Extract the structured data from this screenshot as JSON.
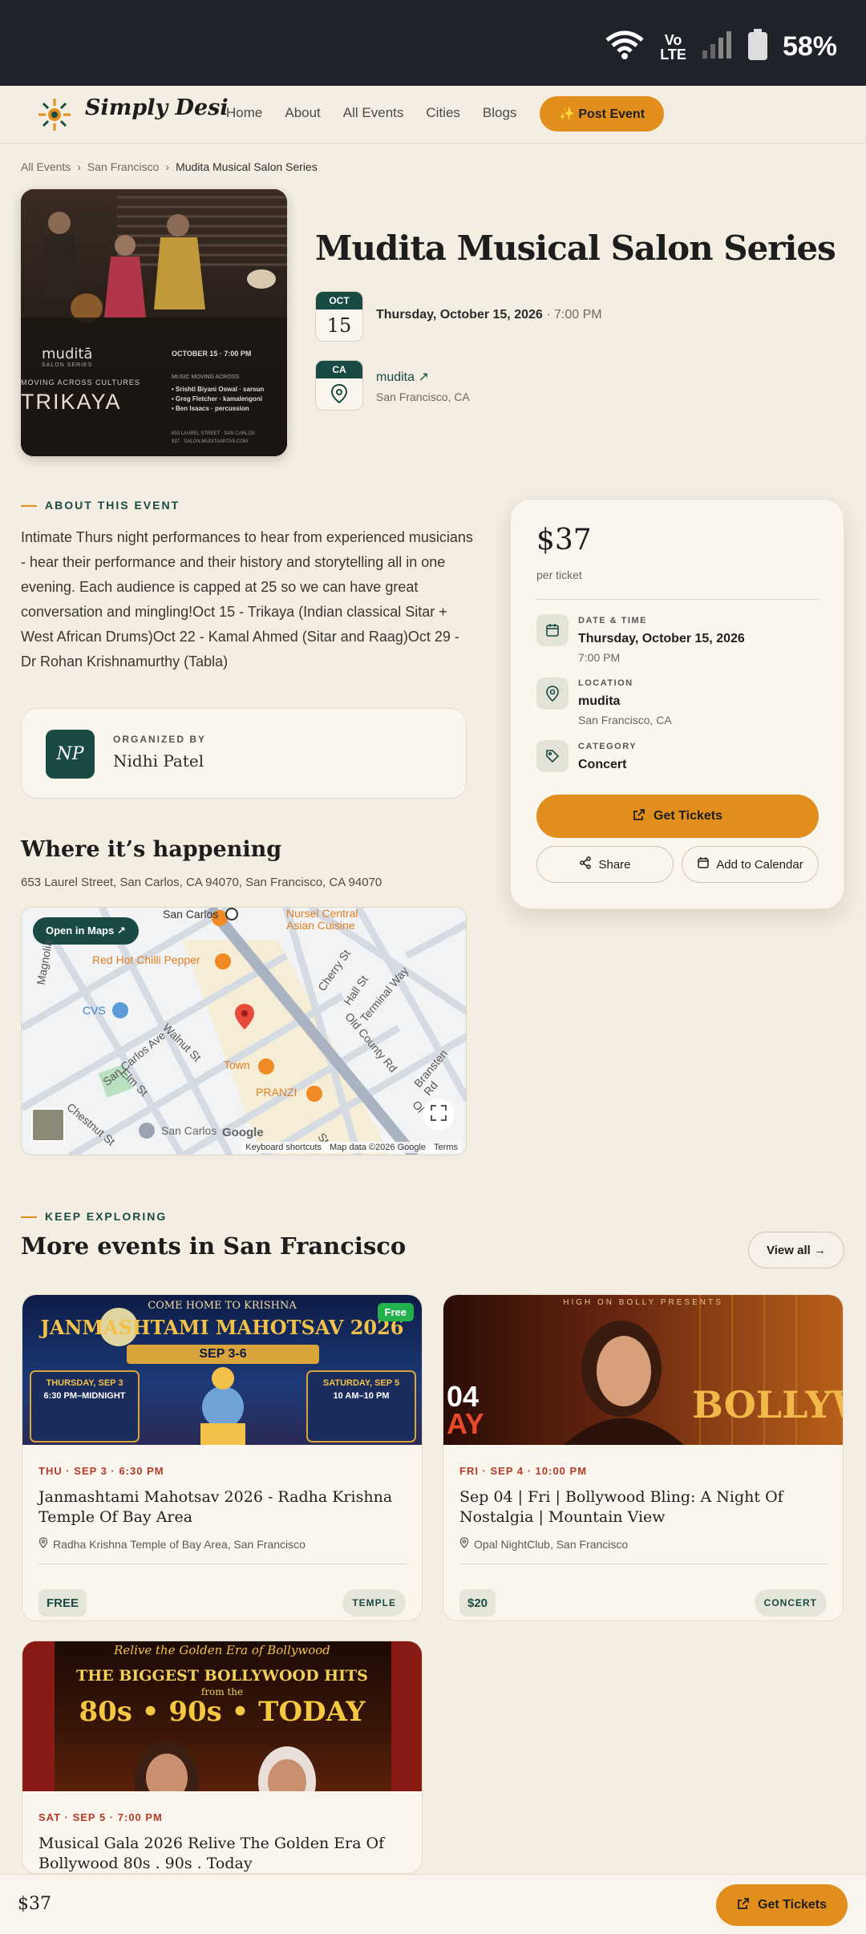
{
  "status_bar": {
    "battery": "58%",
    "network_line1": "Vo",
    "network_line2": "LTE"
  },
  "header": {
    "logo_text": "Simply Desi",
    "nav": [
      "Home",
      "About",
      "All Events",
      "Cities",
      "Blogs"
    ],
    "post_button": "✨ Post Event"
  },
  "breadcrumb": {
    "items": [
      "All Events",
      "San Francisco"
    ],
    "current": "Mudita Musical Salon Series",
    "separator": "›"
  },
  "event": {
    "title": "Mudita Musical Salon Series",
    "month": "OCT",
    "day": "15",
    "date": "Thursday, October 15, 2026",
    "time_sep": "·",
    "time": "7:00 PM",
    "state": "CA",
    "venue": "mudita ↗",
    "city": "San Francisco, CA",
    "poster": {
      "brand": "muditā",
      "brand_sub": "SALON SERIES",
      "date_line": "OCTOBER 15 · 7:00 PM",
      "tagline": "MOVING ACROSS CULTURES",
      "group": "TRIKAYA",
      "lineup_title": "MUSIC MOVING ACROSS",
      "lineup": [
        "• Srishti Biyani Oswal · sarsun",
        "• Greg Fletcher · kamalengoni",
        "• Ben Isaacs · percussion"
      ],
      "address": "653 LAUREL STREET · SAN CARLOS",
      "price_line": "$37 · SALON.MUDITAARTAS.COM"
    }
  },
  "about": {
    "tag": "ABOUT THIS EVENT",
    "text": "Intimate Thurs night performances to hear from experienced musicians - hear their performance and their history and storytelling all in one evening. Each audience is capped at 25 so we can have great conversation and mingling!Oct 15 - Trikaya (Indian classical Sitar + West African Drums)Oct 22 - Kamal Ahmed (Sitar and Raag)Oct 29 - Dr Rohan Krishnamurthy (Tabla)"
  },
  "organizer": {
    "label": "ORGANIZED BY",
    "initials": "NP",
    "name": "Nidhi Patel"
  },
  "where": {
    "title": "Where it’s happening",
    "address": "653 Laurel Street, San Carlos, CA 94070, San Francisco, CA 94070",
    "map_button": "Open in Maps ↗",
    "map_labels": {
      "san_carlos_top": "San Carlos",
      "nursel": "Nursel Central",
      "nursel2": "Asian Cuisine",
      "red_hot": "Red Hot Chilli Pepper",
      "cvs": "CVS",
      "cherry": "Cherry St",
      "hall": "Hall St",
      "terminal": "Terminal Way",
      "old_county": "Old County Rd",
      "san_carlos_ave": "San Carlos Ave",
      "walnut": "Walnut St",
      "elm": "Elm St",
      "town": "Town",
      "pranzi": "PRANZI",
      "chestnut": "Chestnut St",
      "san_carlos_bottom": "San Carlos",
      "bransten": "Bransten Rd",
      "magnolia": "Magnolia",
      "google": "Google",
      "ol": "Ol",
      "st": "St"
    },
    "map_footer": [
      "Keyboard shortcuts",
      "Map data ©2026 Google",
      "Terms"
    ]
  },
  "ticket": {
    "price": "$37",
    "per": "per ticket",
    "date_label": "DATE & TIME",
    "date": "Thursday, October 15, 2026",
    "time": "7:00 PM",
    "location_label": "LOCATION",
    "location": "mudita",
    "location_sub": "San Francisco, CA",
    "category_label": "CATEGORY",
    "category": "Concert",
    "get_tickets": "Get Tickets",
    "share": "Share",
    "add_calendar": "Add to Calendar"
  },
  "more": {
    "tag": "KEEP EXPLORING",
    "title": "More events in San Francisco",
    "view_all": "View all →",
    "events": [
      {
        "when": "THU · SEP 3 · 6:30 PM",
        "title": "Janmashtami Mahotsav 2026 - Radha Krishna Temple Of Bay Area",
        "venue": "Radha Krishna Temple of Bay Area, San Francisco",
        "price": "FREE",
        "category": "TEMPLE",
        "badge": "Free",
        "poster": {
          "top": "COME HOME TO KRISHNA",
          "headline": "JANMASHTAMI MAHOTSAV 2026",
          "dates": "SEP 3-6",
          "left_day": "THURSDAY, SEP 3",
          "left_time": "6:30 PM–MIDNIGHT",
          "right_day": "SATURDAY, SEP 5",
          "right_time": "10 AM–10 PM"
        }
      },
      {
        "when": "FRI · SEP 4 · 10:00 PM",
        "title": "Sep 04 | Fri | Bollywood Bling: A Night Of Nostalgia | Mountain View",
        "venue": "Opal NightClub, San Francisco",
        "price": "$20",
        "category": "CONCERT",
        "poster": {
          "top": "HIGH ON BOLLY PRESENTS",
          "big": "BOLLYWO",
          "left": "04",
          "left2": "AY"
        }
      },
      {
        "when": "SAT · SEP 5 · 7:00 PM",
        "title": "Musical Gala 2026 Relive The Golden Era Of Bollywood 80s . 90s . Today",
        "venue": "",
        "poster": {
          "top": "Relive the Golden Era of Bollywood",
          "line1": "THE BIGGEST BOLLYWOOD HITS",
          "line2": "from the",
          "line3": "80s • 90s • TODAY"
        }
      }
    ]
  },
  "bottom_bar": {
    "price": "$37",
    "button": "Get Tickets"
  },
  "colors": {
    "accent": "#e28e1c",
    "brand": "#1a4a44",
    "background": "#f3ede2",
    "date_red": "#b33b2a"
  }
}
